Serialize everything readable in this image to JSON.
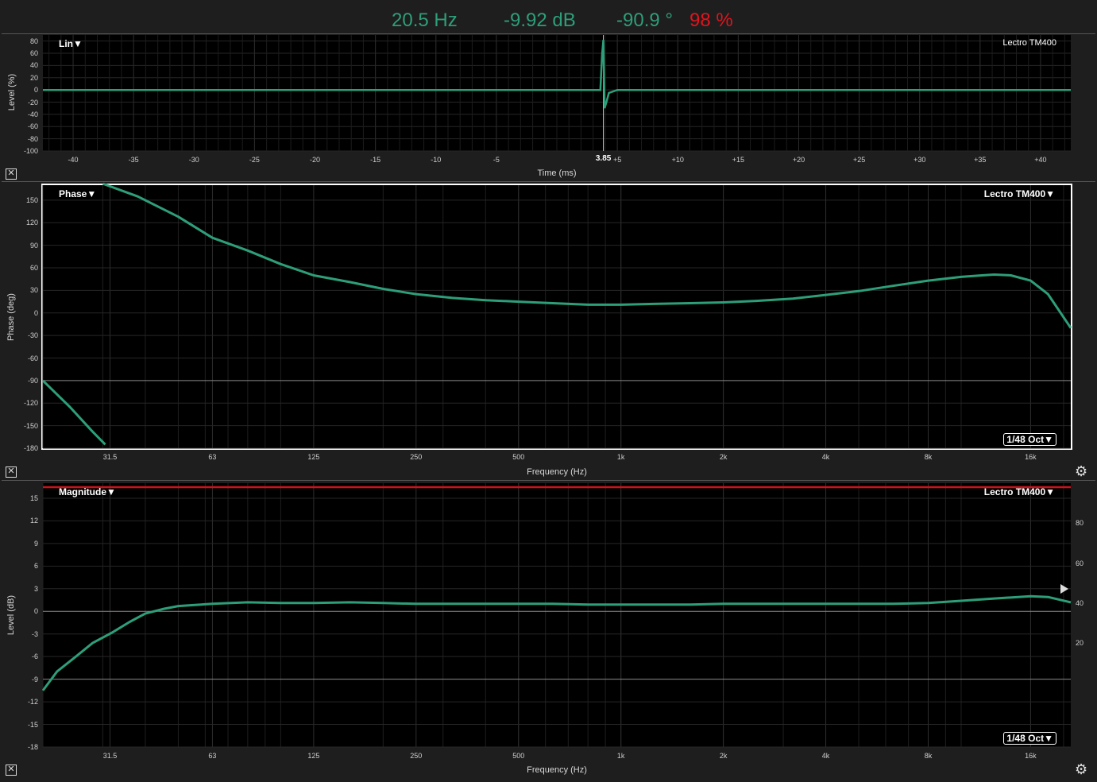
{
  "readout": {
    "frequency": "20.5 Hz",
    "level": "-9.92 dB",
    "phase": "-90.9 °",
    "coherence": "98 %"
  },
  "colors": {
    "trace": "#2e9e7a",
    "coherence": "#d0111b",
    "readout_green": "#2e9e7a",
    "readout_red": "#e0141e",
    "grid": "#2a2a2a",
    "zero": "#9a9a9a"
  },
  "impulse": {
    "mode_label": "Lin▼",
    "source_label": "Lectro TM400",
    "ylabel": "Level (%)",
    "xlabel": "Time (ms)",
    "yticks": [
      "80",
      "60",
      "40",
      "20",
      "0",
      "-20",
      "-40",
      "-60",
      "-80",
      "-100"
    ],
    "xticks": [
      "-40",
      "-35",
      "-30",
      "-25",
      "-20",
      "-15",
      "-10",
      "-5",
      "3.85",
      "+5",
      "+10",
      "+15",
      "+20",
      "+25",
      "+30",
      "+35",
      "+40"
    ],
    "cursor_label": "3.85",
    "close_icon": "close-icon"
  },
  "phase": {
    "mode_label": "Phase▼",
    "source_label": "Lectro TM400▼",
    "smoothing_label": "1/48 Oct▼",
    "ylabel": "Phase (deg)",
    "xlabel": "Frequency (Hz)",
    "yticks": [
      "150",
      "120",
      "90",
      "60",
      "30",
      "0",
      "-30",
      "-60",
      "-90",
      "-120",
      "-150",
      "-180"
    ],
    "xticks": [
      "31.5",
      "63",
      "125",
      "250",
      "500",
      "1k",
      "2k",
      "4k",
      "8k",
      "16k"
    ],
    "close_icon": "close-icon",
    "settings_icon": "gear-icon"
  },
  "magnitude": {
    "mode_label": "Magnitude▼",
    "source_label": "Lectro TM400▼",
    "smoothing_label": "1/48 Oct▼",
    "ylabel": "Level (dB)",
    "xlabel": "Frequency (Hz)",
    "yticks": [
      "15",
      "12",
      "9",
      "6",
      "3",
      "0",
      "-3",
      "-6",
      "-9",
      "-12",
      "-15",
      "-18"
    ],
    "yticks_right": [
      "80",
      "60",
      "40",
      "20"
    ],
    "xticks": [
      "31.5",
      "63",
      "125",
      "250",
      "500",
      "1k",
      "2k",
      "4k",
      "8k",
      "16k"
    ],
    "close_icon": "close-icon",
    "settings_icon": "gear-icon"
  },
  "chart_data": [
    {
      "type": "line",
      "xlabel": "Time (ms)",
      "ylabel": "Level (%)",
      "xlim": [
        -42.5,
        42.5
      ],
      "ylim": [
        -100,
        90
      ],
      "series": [
        {
          "x": [
            -42.5,
            3.6,
            3.75,
            3.85,
            3.95,
            4.1,
            4.3,
            5,
            42.5
          ],
          "y": [
            0,
            0,
            60,
            82,
            -30,
            -20,
            -5,
            0,
            0
          ]
        }
      ]
    },
    {
      "type": "line",
      "xlabel": "Frequency (Hz)",
      "ylabel": "Phase (deg)",
      "xscale": "log",
      "xlim": [
        20,
        21000
      ],
      "ylim": [
        -180,
        170
      ],
      "series": [
        {
          "x": [
            20,
            24,
            28,
            30.5
          ],
          "y": [
            -90,
            -125,
            -158,
            -175
          ]
        },
        {
          "x": [
            30,
            38,
            50,
            63,
            80,
            100,
            125,
            160,
            200,
            250,
            320,
            400,
            500,
            630,
            800,
            1000,
            1250,
            1600,
            2000,
            2500,
            3200,
            4000,
            5000,
            6300,
            8000,
            10000,
            11500,
            12500,
            14000,
            16000,
            18000,
            21000
          ],
          "y": [
            172,
            155,
            128,
            100,
            83,
            65,
            50,
            41,
            32,
            25,
            20,
            17,
            15,
            13,
            11,
            11,
            12,
            13,
            14,
            16,
            19,
            24,
            29,
            36,
            43,
            48,
            50,
            51,
            50,
            43,
            25,
            -20
          ]
        }
      ]
    },
    {
      "type": "line",
      "xlabel": "Frequency (Hz)",
      "ylabel": "Level (dB)",
      "xscale": "log",
      "xlim": [
        20,
        21000
      ],
      "ylim": [
        -18,
        17
      ],
      "series": [
        {
          "x": [
            20,
            22,
            25,
            28,
            32,
            36,
            40,
            45,
            50,
            63,
            80,
            100,
            125,
            160,
            200,
            250,
            320,
            400,
            500,
            630,
            800,
            1000,
            1250,
            1600,
            2000,
            2500,
            3200,
            4000,
            5000,
            6300,
            8000,
            10000,
            12500,
            16000,
            18000,
            21000
          ],
          "y": [
            -10.5,
            -8,
            -6,
            -4.2,
            -2.8,
            -1.4,
            -0.3,
            0.3,
            0.7,
            1,
            1.2,
            1.1,
            1.1,
            1.2,
            1.1,
            1,
            1,
            1,
            1,
            1,
            0.9,
            0.9,
            0.9,
            0.9,
            1,
            1,
            1,
            1,
            1,
            1,
            1.1,
            1.4,
            1.7,
            2,
            1.9,
            1.2
          ]
        },
        {
          "name": "Coherence",
          "x": [
            20,
            21000
          ],
          "y": [
            98,
            98
          ]
        }
      ]
    }
  ]
}
